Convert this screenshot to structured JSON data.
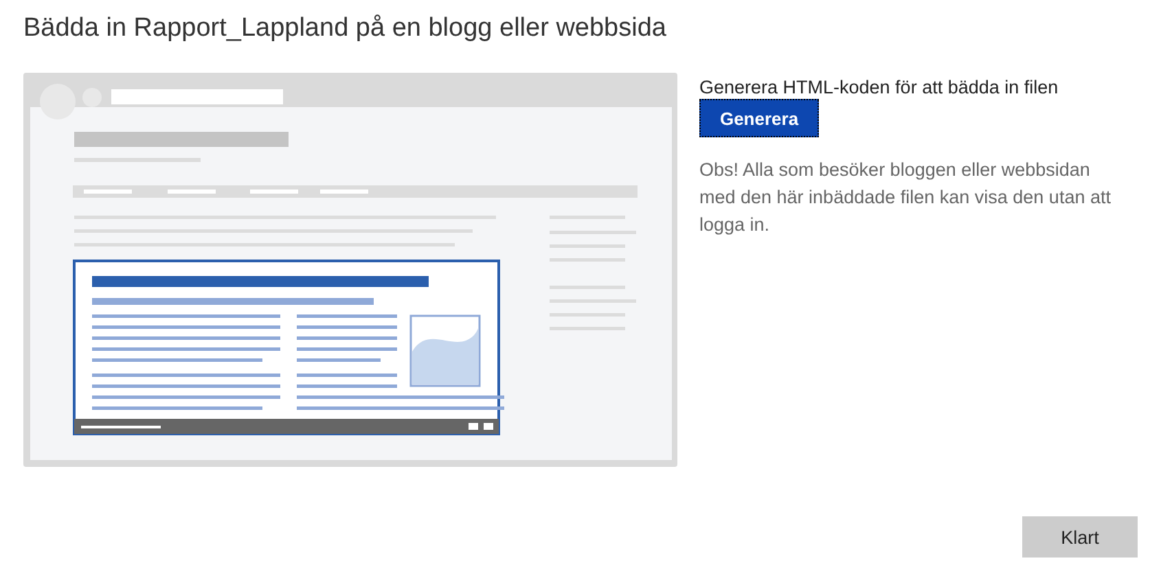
{
  "title": "Bädda in Rapport_Lappland på en blogg eller webbsida",
  "generate": {
    "label": "Generera HTML-koden för att bädda in filen",
    "button": {
      "text": "Generera",
      "focused": true
    }
  },
  "note": "Obs! Alla som besöker bloggen eller webbsidan med den här inbäddade filen kan visa den utan att logga in.",
  "done_button": "Klart"
}
